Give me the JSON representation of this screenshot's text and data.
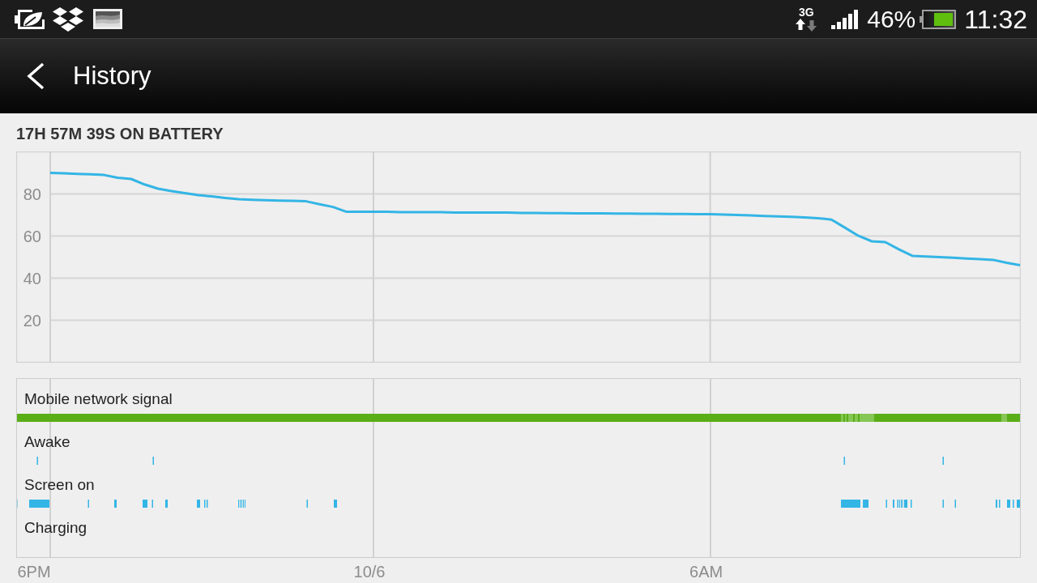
{
  "status_bar": {
    "network_type": "3G",
    "battery_level": "46%",
    "time": "11:32"
  },
  "action_bar": {
    "title": "History"
  },
  "summary": "17H 57M 39S ON BATTERY",
  "history_chart": {
    "chart_data": {
      "type": "line",
      "categories": [
        null,
        null,
        null,
        null,
        null,
        null,
        null,
        null,
        null,
        null,
        null,
        null,
        null,
        null,
        null,
        null,
        null,
        null,
        null,
        null,
        null,
        null,
        null,
        null,
        null,
        null,
        null,
        null,
        null,
        null,
        null,
        null,
        null,
        null,
        null,
        null,
        null,
        null,
        null,
        null,
        null,
        null,
        null,
        null,
        null,
        null,
        null,
        null,
        null,
        null,
        null,
        null,
        null,
        null,
        null,
        null,
        null,
        null,
        null,
        null,
        null,
        null,
        null,
        null,
        null,
        null,
        null,
        null,
        null,
        null,
        null,
        null,
        null
      ],
      "series": [
        {
          "color": "#33b5e5",
          "values": [
            90,
            89.8,
            89.5,
            89.3,
            89.0,
            87.7,
            87.1,
            84.5,
            82.5,
            81.4,
            80.4,
            79.4,
            78.8,
            78.1,
            77.5,
            77.2,
            77.0,
            76.8,
            76.7,
            76.5,
            75.1,
            73.8,
            71.5,
            71.5,
            71.5,
            71.5,
            71.4,
            71.4,
            71.3,
            71.3,
            71.2,
            71.2,
            71.2,
            71.1,
            71.1,
            71.0,
            71.0,
            70.9,
            70.9,
            70.8,
            70.8,
            70.8,
            70.7,
            70.7,
            70.6,
            70.6,
            70.5,
            70.5,
            70.4,
            70.4,
            70.2,
            70.0,
            69.8,
            69.5,
            69.3,
            69.1,
            68.9,
            68.5,
            67.8,
            64.0,
            60.1,
            57.5,
            57.1,
            53.7,
            50.6,
            50.3,
            50.0,
            49.7,
            49.3,
            49.0,
            48.7,
            47.3,
            46.2
          ]
        }
      ],
      "ylim": [
        0,
        100
      ],
      "yticks": [
        {
          "value": 20,
          "label": "20"
        },
        {
          "value": 40,
          "label": "40"
        },
        {
          "value": 60,
          "label": "60"
        },
        {
          "value": 80,
          "label": "80"
        }
      ],
      "grid": true
    },
    "tracks": [
      {
        "kind": "signal",
        "label": "Mobile network signal"
      },
      {
        "kind": "events",
        "label": "Awake"
      },
      {
        "kind": "events",
        "label": "Screen on"
      },
      {
        "kind": "events",
        "label": "Charging"
      }
    ],
    "time_axis": [
      "6PM",
      "10/6",
      "6AM"
    ]
  }
}
